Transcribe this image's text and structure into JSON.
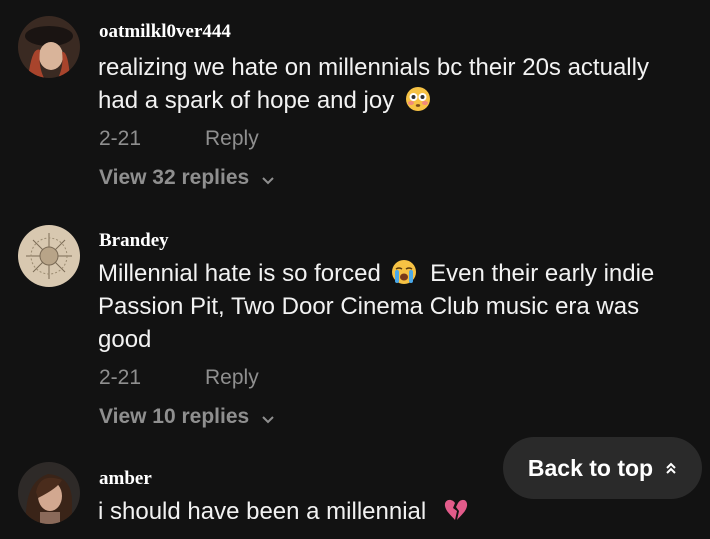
{
  "comments": [
    {
      "username": "oatmilkl0ver444",
      "text_lines": [
        "realizing we hate on millennials bc their 20s actually",
        "had a spark of hope and joy"
      ],
      "emoji": "flushed-face-emoji",
      "date": "2-21",
      "reply_label": "Reply",
      "view_replies": "View 32 replies"
    },
    {
      "username": "Brandey",
      "text_lines": [
        "Millennial hate is so forced",
        "Even their early indie",
        "Passion Pit, Two Door Cinema Club music era was",
        "good"
      ],
      "emoji": "crying-face-emoji",
      "date": "2-21",
      "reply_label": "Reply",
      "view_replies": "View 10 replies"
    },
    {
      "username": "amber",
      "text": "i should have been a millennial",
      "emoji": "broken-heart-emoji"
    }
  ],
  "back_to_top": "Back to top",
  "colors": {
    "background": "#121212",
    "muted": "#8f8f8f",
    "pill": "#2a2a2a"
  }
}
